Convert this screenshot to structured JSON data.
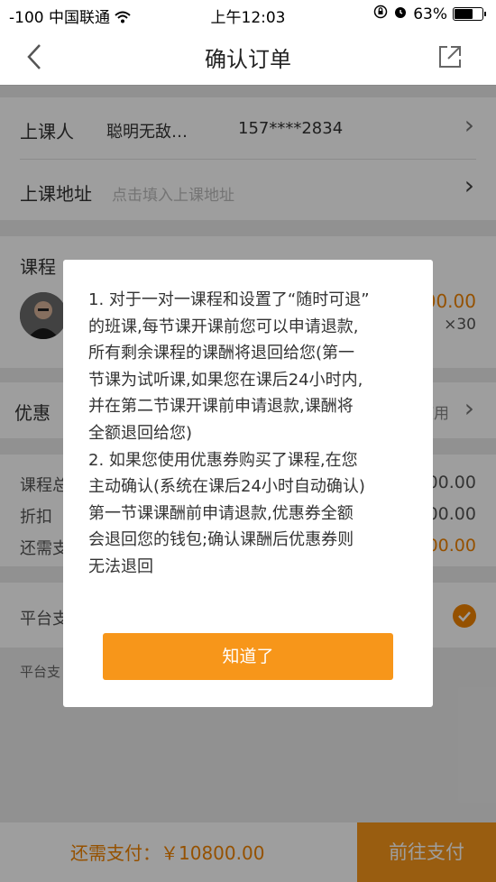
{
  "status_bar": {
    "signal": "-100",
    "carrier": "中国联通",
    "time": "上午12:03",
    "battery": "63%"
  },
  "nav": {
    "title": "确认订单"
  },
  "student": {
    "label": "上课人",
    "name": "聪明无敌…",
    "phone": "157****2834"
  },
  "address": {
    "label": "上课地址",
    "placeholder": "点击填入上课地址"
  },
  "course": {
    "label": "课程",
    "price_partial": "00.00",
    "quantity": "×30"
  },
  "discount": {
    "label": "优惠",
    "action_partial": "使用"
  },
  "summary": {
    "row1_label": "课程总",
    "row1_value": "00.00",
    "row2_label": "折扣",
    "row2_value": "00.00",
    "row3_label": "还需支",
    "row3_value": "00.00"
  },
  "platform": {
    "label": "平台支",
    "note": "平台支"
  },
  "modal": {
    "text_line1": "1. 对于一对一课程和设置了“随时可退”",
    "text_line2": "的班课,每节课开课前您可以申请退款,",
    "text_line3": "所有剩余课程的课酬将退回给您(第一",
    "text_line4": "节课为试听课,如果您在课后24小时内,",
    "text_line5": "并在第二节课开课前申请退款,课酬将",
    "text_line6": "全额退回给您)",
    "text_line7": "2. 如果您使用优惠券购买了课程,在您",
    "text_line8": "主动确认(系统在课后24小时自动确认)",
    "text_line9": "第一节课课酬前申请退款,优惠券全额",
    "text_line10": "会退回您的钱包;确认课酬后优惠券则",
    "text_line11": "无法退回",
    "button": "知道了"
  },
  "bottom": {
    "summary": "还需支付：￥10800.00",
    "pay_button": "前往支付"
  },
  "colors": {
    "accent": "#f7961a",
    "accent_text": "#f08300"
  }
}
